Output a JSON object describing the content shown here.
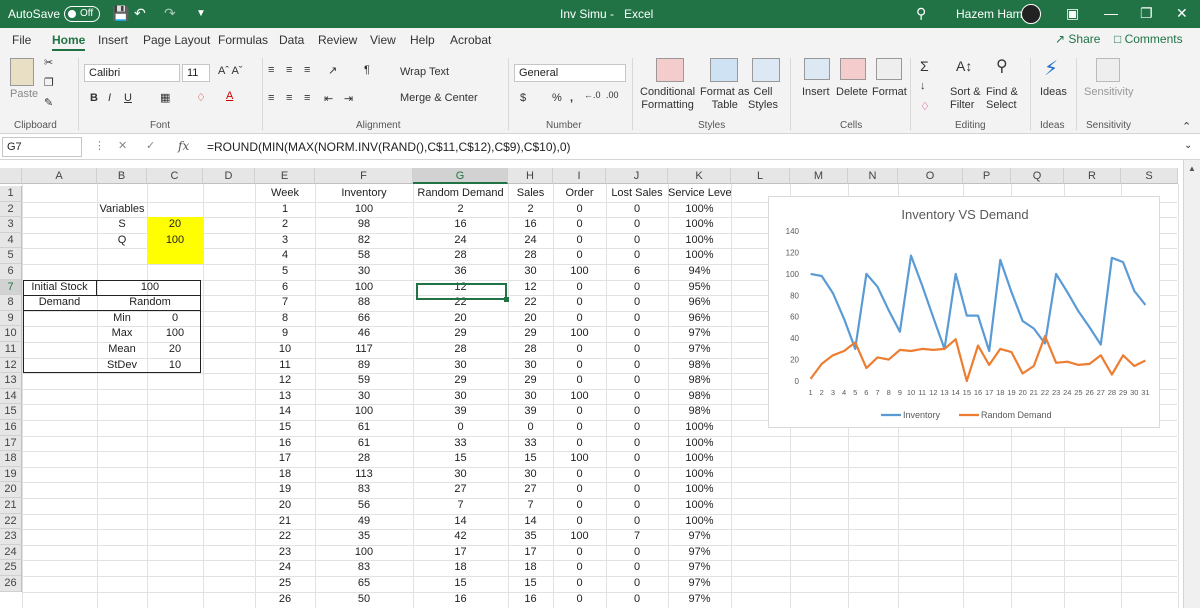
{
  "app": {
    "autosave_label": "AutoSave",
    "autosave_state": "Off",
    "file_title": "Inv Simu",
    "title_sep": "-",
    "app_name": "Excel",
    "user_name": "Hazem Hamza"
  },
  "tabs": [
    "File",
    "Home",
    "Insert",
    "Page Layout",
    "Formulas",
    "Data",
    "Review",
    "View",
    "Help",
    "Acrobat"
  ],
  "active_tab": "Home",
  "share_label": "Share",
  "comments_label": "Comments",
  "ribbon": {
    "paste": "Paste",
    "font_name": "Calibri",
    "font_size": "11",
    "wrap_text": "Wrap Text",
    "merge_center": "Merge & Center",
    "number_format": "General",
    "conditional_formatting": "Conditional\nFormatting",
    "format_as_table": "Format as\nTable",
    "cell_styles": "Cell\nStyles",
    "insert": "Insert",
    "delete": "Delete",
    "format": "Format",
    "sort_filter": "Sort &\nFilter",
    "find_select": "Find &\nSelect",
    "ideas": "Ideas",
    "sensitivity": "Sensitivity",
    "groups": [
      "Clipboard",
      "Font",
      "Alignment",
      "Number",
      "Styles",
      "Cells",
      "Editing",
      "Ideas",
      "Sensitivity"
    ],
    "bold": "B",
    "italic": "I",
    "underline": "U",
    "currency": "$",
    "percent": "%",
    "comma": ","
  },
  "formula_bar": {
    "name_box": "G7",
    "fx": "fx",
    "formula": "=ROUND(MIN(MAX(NORM.INV(RAND(),C$11,C$12),C$9),C$10),0)"
  },
  "columns": [
    "A",
    "B",
    "C",
    "D",
    "E",
    "F",
    "G",
    "H",
    "I",
    "J",
    "K",
    "L",
    "M",
    "N",
    "O",
    "P",
    "Q",
    "R",
    "S"
  ],
  "rows": [
    "1",
    "2",
    "3",
    "4",
    "5",
    "6",
    "7",
    "8",
    "9",
    "10",
    "11",
    "12",
    "13",
    "14",
    "15",
    "16",
    "17",
    "18",
    "19",
    "20",
    "21",
    "22",
    "23",
    "24",
    "25",
    "26"
  ],
  "left_table": {
    "variables": "Variables",
    "s_label": "S",
    "s_value": "20",
    "q_label": "Q",
    "q_value": "100",
    "initial_stock_label": "Initial Stock",
    "initial_stock_value": "100",
    "demand_label": "Demand",
    "demand_value": "Random",
    "min_label": "Min",
    "min_value": "0",
    "max_label": "Max",
    "max_value": "100",
    "mean_label": "Mean",
    "mean_value": "20",
    "stdev_label": "StDev",
    "stdev_value": "10"
  },
  "table_headers": [
    "Week",
    "Inventory",
    "Random Demand",
    "Sales",
    "Order",
    "Lost Sales",
    "Service Level"
  ],
  "table_rows": [
    [
      "1",
      "100",
      "2",
      "2",
      "0",
      "0",
      "100%"
    ],
    [
      "2",
      "98",
      "16",
      "16",
      "0",
      "0",
      "100%"
    ],
    [
      "3",
      "82",
      "24",
      "24",
      "0",
      "0",
      "100%"
    ],
    [
      "4",
      "58",
      "28",
      "28",
      "0",
      "0",
      "100%"
    ],
    [
      "5",
      "30",
      "36",
      "30",
      "100",
      "6",
      "94%"
    ],
    [
      "6",
      "100",
      "12",
      "12",
      "0",
      "0",
      "95%"
    ],
    [
      "7",
      "88",
      "22",
      "22",
      "0",
      "0",
      "96%"
    ],
    [
      "8",
      "66",
      "20",
      "20",
      "0",
      "0",
      "96%"
    ],
    [
      "9",
      "46",
      "29",
      "29",
      "100",
      "0",
      "97%"
    ],
    [
      "10",
      "117",
      "28",
      "28",
      "0",
      "0",
      "97%"
    ],
    [
      "11",
      "89",
      "30",
      "30",
      "0",
      "0",
      "98%"
    ],
    [
      "12",
      "59",
      "29",
      "29",
      "0",
      "0",
      "98%"
    ],
    [
      "13",
      "30",
      "30",
      "30",
      "100",
      "0",
      "98%"
    ],
    [
      "14",
      "100",
      "39",
      "39",
      "0",
      "0",
      "98%"
    ],
    [
      "15",
      "61",
      "0",
      "0",
      "0",
      "0",
      "100%"
    ],
    [
      "16",
      "61",
      "33",
      "33",
      "0",
      "0",
      "100%"
    ],
    [
      "17",
      "28",
      "15",
      "15",
      "100",
      "0",
      "100%"
    ],
    [
      "18",
      "113",
      "30",
      "30",
      "0",
      "0",
      "100%"
    ],
    [
      "19",
      "83",
      "27",
      "27",
      "0",
      "0",
      "100%"
    ],
    [
      "20",
      "56",
      "7",
      "7",
      "0",
      "0",
      "100%"
    ],
    [
      "21",
      "49",
      "14",
      "14",
      "0",
      "0",
      "100%"
    ],
    [
      "22",
      "35",
      "42",
      "35",
      "100",
      "7",
      "97%"
    ],
    [
      "23",
      "100",
      "17",
      "17",
      "0",
      "0",
      "97%"
    ],
    [
      "24",
      "83",
      "18",
      "18",
      "0",
      "0",
      "97%"
    ],
    [
      "25",
      "65",
      "15",
      "15",
      "0",
      "0",
      "97%"
    ],
    [
      "26",
      "50",
      "16",
      "16",
      "0",
      "0",
      "97%"
    ]
  ],
  "chart_data": {
    "type": "line",
    "title": "Inventory VS Demand",
    "x": [
      1,
      2,
      3,
      4,
      5,
      6,
      7,
      8,
      9,
      10,
      11,
      12,
      13,
      14,
      15,
      16,
      17,
      18,
      19,
      20,
      21,
      22,
      23,
      24,
      25,
      26,
      27,
      28,
      29,
      30,
      31
    ],
    "ylim": [
      0,
      140
    ],
    "yticks": [
      0,
      20,
      40,
      60,
      80,
      100,
      120,
      140
    ],
    "legend_position": "bottom",
    "series": [
      {
        "name": "Inventory",
        "color": "#5b9bd5",
        "values": [
          100,
          98,
          82,
          58,
          30,
          100,
          88,
          66,
          46,
          117,
          89,
          59,
          30,
          100,
          61,
          61,
          28,
          113,
          83,
          56,
          49,
          35,
          100,
          83,
          65,
          50,
          34,
          115,
          111,
          84,
          71
        ]
      },
      {
        "name": "Random Demand",
        "color": "#ed7d31",
        "values": [
          2,
          16,
          24,
          28,
          36,
          12,
          22,
          20,
          29,
          28,
          30,
          29,
          30,
          39,
          0,
          33,
          15,
          30,
          27,
          7,
          14,
          42,
          17,
          18,
          15,
          16,
          24,
          6,
          24,
          14,
          19
        ]
      }
    ]
  }
}
